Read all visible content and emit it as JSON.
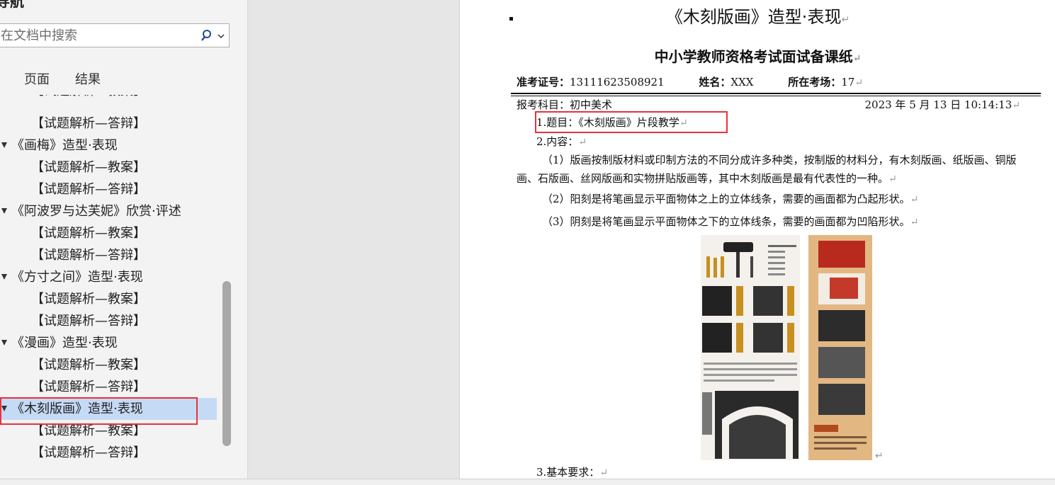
{
  "nav": {
    "title": "导航",
    "search_placeholder": "在文档中搜索",
    "tabs": [
      {
        "label": "页面"
      },
      {
        "label": "结果"
      }
    ],
    "items": [
      {
        "label": "【试题解析—教案】",
        "level": 2
      },
      {
        "label": "【试题解析—答辩】",
        "level": 2
      },
      {
        "label": "《画梅》造型·表现",
        "level": 1
      },
      {
        "label": "【试题解析—教案】",
        "level": 2
      },
      {
        "label": "【试题解析—答辩】",
        "level": 2
      },
      {
        "label": "《阿波罗与达芙妮》欣赏·评述",
        "level": 1
      },
      {
        "label": "【试题解析—教案】",
        "level": 2
      },
      {
        "label": "【试题解析—答辩】",
        "level": 2
      },
      {
        "label": "《方寸之间》造型·表现",
        "level": 1
      },
      {
        "label": "【试题解析—教案】",
        "level": 2
      },
      {
        "label": "【试题解析—答辩】",
        "level": 2
      },
      {
        "label": "《漫画》造型·表现",
        "level": 1
      },
      {
        "label": "【试题解析—教案】",
        "level": 2
      },
      {
        "label": "【试题解析—答辩】",
        "level": 2
      },
      {
        "label": "《木刻版画》造型·表现",
        "level": 1,
        "selected": true
      },
      {
        "label": "【试题解析—教案】",
        "level": 2
      },
      {
        "label": "【试题解析—答辩】",
        "level": 2
      }
    ]
  },
  "doc": {
    "title": "《木刻版画》造型·表现",
    "subtitle": "中小学教师资格考试面试备课纸",
    "ticket_label": "准考证号：",
    "ticket_value": "13111623508921",
    "name_label": "姓名：",
    "name_value": "XXX",
    "venue_label": "所在考场：",
    "venue_value": "17",
    "subject": "报考科目：初中美术",
    "datetime": "2023 年 5 月 13 日 10:14:13",
    "question_title": "1.题目：《木刻版画》片段教学",
    "content_label": "2.内容：",
    "p1": "（1）版画按制版材料或印制方法的不同分成许多种类，按制版的材料分，有木刻版画、纸版画、铜版画、石版画、丝网版画和实物拼贴版画等，其中木刻版画是最有代表性的一种。",
    "p2": "（2）阳刻是将笔画显示平面物体之上的立体线条，需要的画面都为凸起形状。",
    "p3": "（3）阴刻是将笔画显示平面物体之下的立体线条，需要的画面都为凹陷形状。",
    "requirements": "3.基本要求："
  },
  "colors": {
    "highlight": "#e8323c",
    "selection": "#c5daf5",
    "nav_bg": "#f3f3f3"
  },
  "icons": {
    "search": "search-icon",
    "dropdown": "chevron-down-icon",
    "collapse": "caret-down-icon",
    "paragraph_mark": "↵"
  }
}
